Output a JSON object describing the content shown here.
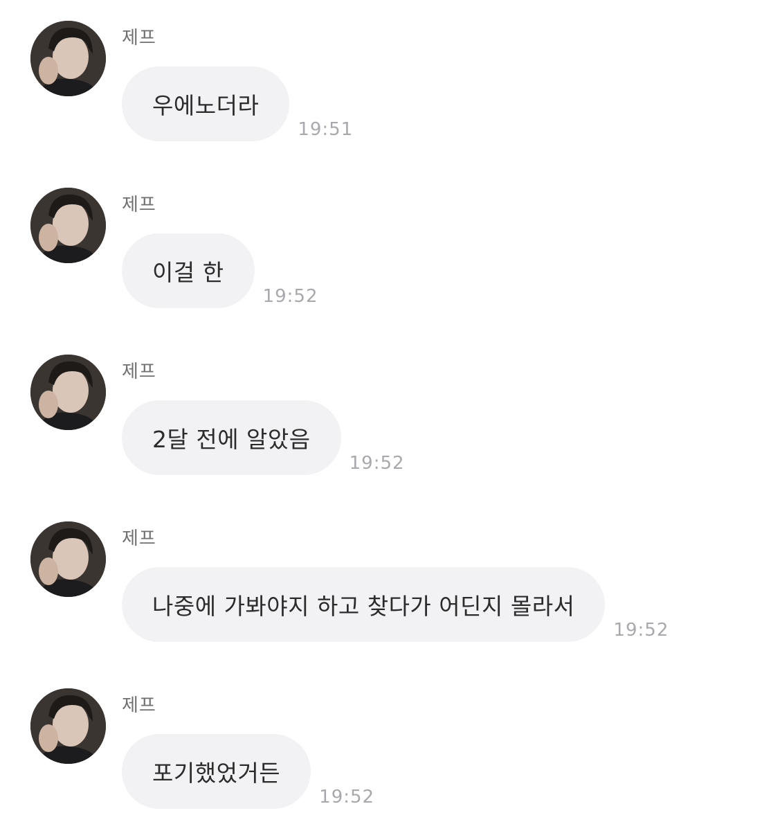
{
  "messages": [
    {
      "sender": "제프",
      "text": "우에노더라",
      "time": "19:51"
    },
    {
      "sender": "제프",
      "text": "이걸 한",
      "time": "19:52"
    },
    {
      "sender": "제프",
      "text": "2달 전에 알았음",
      "time": "19:52"
    },
    {
      "sender": "제프",
      "text": "나중에 가봐야지 하고 찾다가 어딘지 몰라서",
      "time": "19:52"
    },
    {
      "sender": "제프",
      "text": "포기했었거든",
      "time": "19:52"
    }
  ],
  "colors": {
    "bubble": "#f2f2f4",
    "sender": "#6f6f6f",
    "time": "#a9a9ad",
    "text": "#2b2b2b"
  },
  "icons": {
    "avatar": "profile-photo"
  }
}
